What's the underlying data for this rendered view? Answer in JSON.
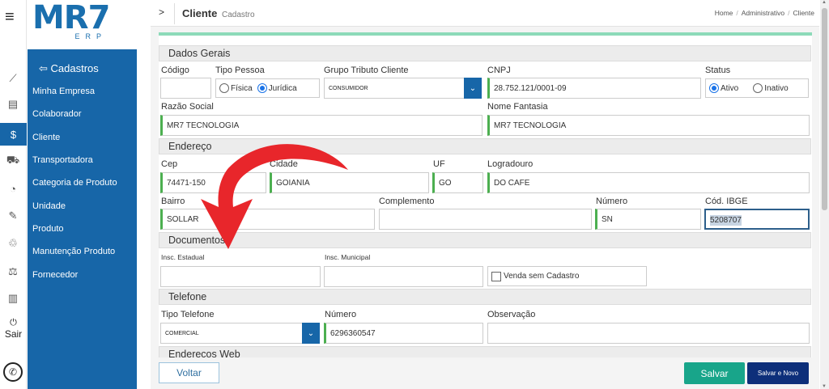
{
  "logo": {
    "brand": "MR7",
    "suffix": "ERP"
  },
  "sidebar": {
    "title": "⇦ Cadastros",
    "items": [
      {
        "label": "Minha Empresa"
      },
      {
        "label": "Colaborador"
      },
      {
        "label": "Cliente"
      },
      {
        "label": "Transportadora"
      },
      {
        "label": "Categoria de Produto"
      },
      {
        "label": "Unidade"
      },
      {
        "label": "Produto"
      },
      {
        "label": "Manutenção Produto"
      },
      {
        "label": "Fornecedor"
      }
    ],
    "exit_label": "Sair",
    "icons": [
      "chart-icon",
      "document-icon",
      "money-icon",
      "truck-icon",
      "dashboard-icon",
      "pen-icon",
      "recycle-icon",
      "cash-icon",
      "receipt-icon"
    ]
  },
  "header": {
    "title": "Cliente",
    "subtitle": "Cadastro",
    "breadcrumbs": [
      "Home",
      "Administrativo",
      "Cliente"
    ]
  },
  "form": {
    "dados_gerais": {
      "section": "Dados Gerais",
      "codigo_label": "Código",
      "codigo_value": "",
      "tipo_pessoa_label": "Tipo Pessoa",
      "tipo_pessoa_options": [
        "Física",
        "Jurídica"
      ],
      "tipo_pessoa_selected": "Jurídica",
      "grupo_label": "Grupo Tributo Cliente",
      "grupo_value": "CONSUMIDOR",
      "cnpj_label": "CNPJ",
      "cnpj_value": "28.752.121/0001-09",
      "status_label": "Status",
      "status_options": [
        "Ativo",
        "Inativo"
      ],
      "status_selected": "Ativo",
      "razao_label": "Razão Social",
      "razao_value": "MR7 TECNOLOGIA",
      "fantasia_label": "Nome Fantasia",
      "fantasia_value": "MR7 TECNOLOGIA"
    },
    "endereco": {
      "section": "Endereço",
      "cep_label": "Cep",
      "cep_value": "74471-150",
      "cidade_label": "Cidade",
      "cidade_value": "GOIANIA",
      "uf_label": "UF",
      "uf_value": "GO",
      "logradouro_label": "Logradouro",
      "logradouro_value": "DO CAFE",
      "bairro_label": "Bairro",
      "bairro_value": "SOLLAR",
      "complemento_label": "Complemento",
      "complemento_value": "",
      "numero_label": "Número",
      "numero_value": "SN",
      "ibge_label": "Cód. IBGE",
      "ibge_value": "5208707"
    },
    "documentos": {
      "section": "Documentos",
      "inscricao_estadual_label": "Insc. Estadual",
      "inscricao_estadual_value": "",
      "inscricao_municipal_label": "Insc. Municipal",
      "inscricao_municipal_value": "",
      "venda_sem_cadastro_label": "Venda sem Cadastro"
    },
    "telefone": {
      "section": "Telefone",
      "tipo_label": "Tipo Telefone",
      "tipo_value": "COMERCIAL",
      "numero_label": "Número",
      "numero_value": "6296360547",
      "observacao_label": "Observação",
      "observacao_value": ""
    },
    "enderecos_web": {
      "section": "Endereços Web"
    }
  },
  "actions": {
    "voltar": "Voltar",
    "salvar": "Salvar",
    "salvar_novo": "Salvar e Novo"
  },
  "colors": {
    "primary": "#1766a8",
    "accent_green": "#18a58a",
    "dark_blue": "#0d2f7a",
    "arrow_red": "#e8262b",
    "panel_top": "#8ddab9"
  }
}
